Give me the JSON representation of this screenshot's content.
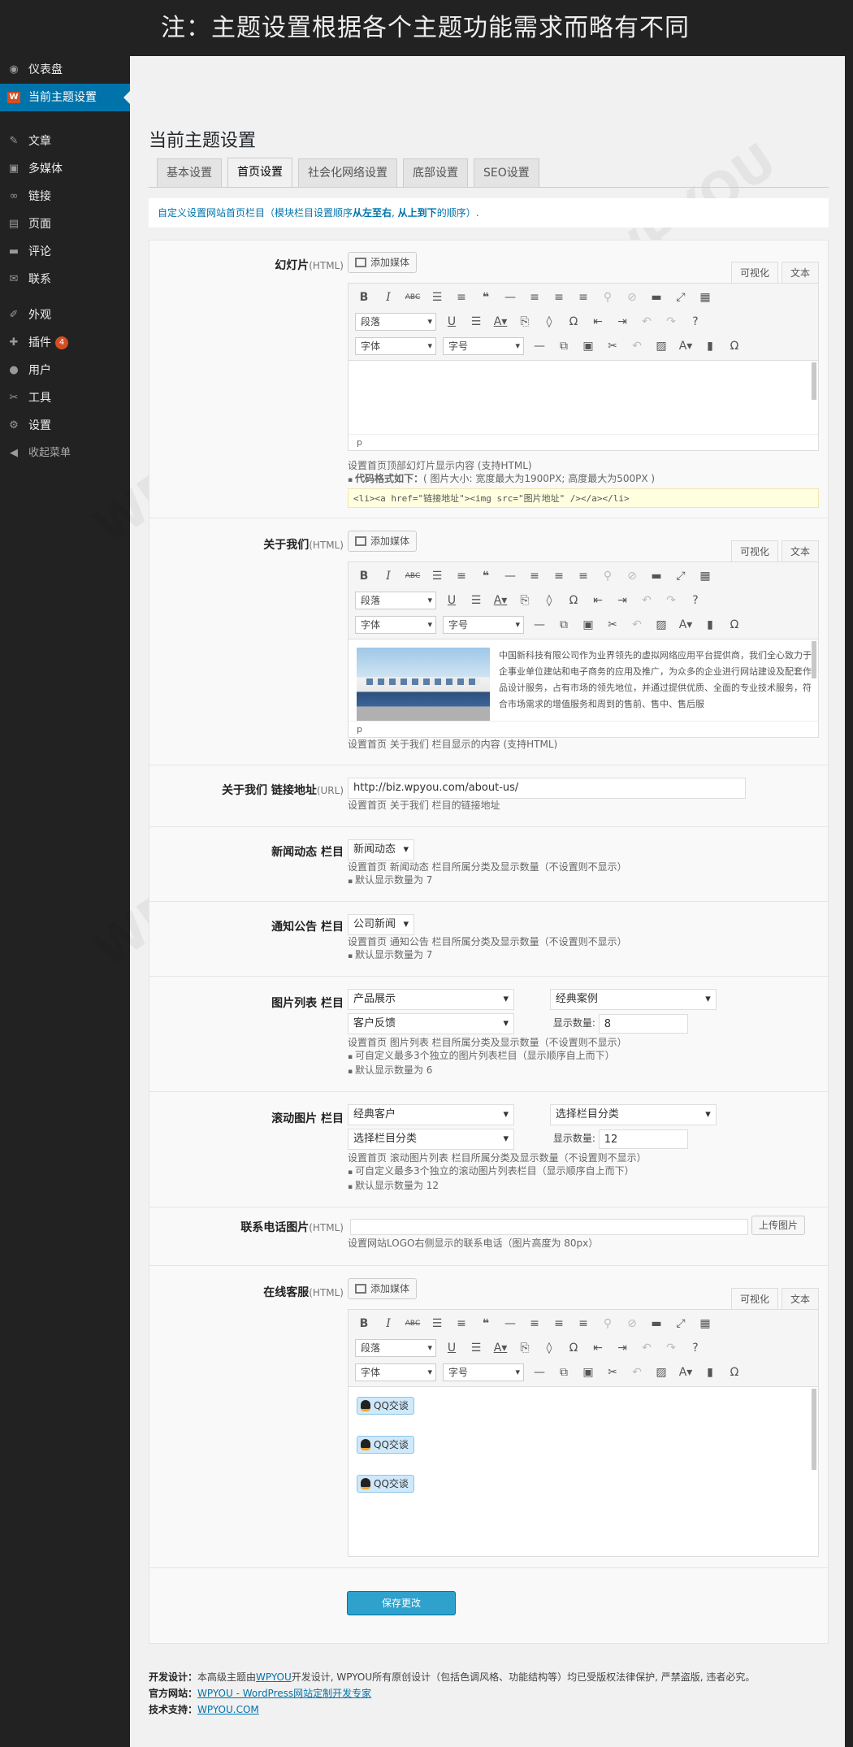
{
  "banner": {
    "text": "注：主题设置根据各个主题功能需求而略有不同"
  },
  "sidebar": {
    "items": [
      {
        "icon": "dashboard-icon",
        "glyph": "◉",
        "label": "仪表盘"
      },
      {
        "icon": "theme-settings-icon",
        "glyph": "W",
        "label": "当前主题设置",
        "active": true
      },
      {
        "icon": "posts-pin-icon",
        "glyph": "✎",
        "label": "文章"
      },
      {
        "icon": "media-icon",
        "glyph": "▣",
        "label": "多媒体"
      },
      {
        "icon": "links-icon",
        "glyph": "∞",
        "label": "链接"
      },
      {
        "icon": "pages-icon",
        "glyph": "▤",
        "label": "页面"
      },
      {
        "icon": "comments-icon",
        "glyph": "▬",
        "label": "评论"
      },
      {
        "icon": "contact-mail-icon",
        "glyph": "✉",
        "label": "联系"
      },
      {
        "icon": "appearance-brush-icon",
        "glyph": "✐",
        "label": "外观"
      },
      {
        "icon": "plugins-icon",
        "glyph": "✚",
        "label": "插件",
        "badge": "4"
      },
      {
        "icon": "users-icon",
        "glyph": "●",
        "label": "用户"
      },
      {
        "icon": "tools-wrench-icon",
        "glyph": "✂",
        "label": "工具"
      },
      {
        "icon": "settings-icon",
        "glyph": "⚙",
        "label": "设置"
      },
      {
        "icon": "collapse-arrow-icon",
        "glyph": "◀",
        "label": "收起菜单"
      }
    ]
  },
  "page": {
    "title": "当前主题设置"
  },
  "tabs": [
    "基本设置",
    "首页设置",
    "社会化网络设置",
    "底部设置",
    "SEO设置"
  ],
  "active_tab": "首页设置",
  "notice": {
    "prefix": "自定义设置网站首页栏目（模块栏目设置顺序",
    "b1": "从左至右",
    "mid": ", ",
    "b2": "从上到下",
    "suffix": "的顺序）."
  },
  "editor_common": {
    "add_media": "添加媒体",
    "visual": "可视化",
    "text": "文本",
    "paragraph": "段落",
    "font": "字体",
    "size": "字号",
    "path": "p"
  },
  "slides": {
    "label": "幻灯片",
    "hint": "(HTML)",
    "desc": "设置首页顶部幻灯片显示内容 (支持HTML)",
    "code_title": "代码格式如下：",
    "code_note": "( 图片大小: 宽度最大为1900PX; 高度最大为500PX )",
    "code": "<li><a href=\"链接地址\"><img src=\"图片地址\" /></a></li>"
  },
  "about": {
    "label": "关于我们",
    "hint": "(HTML)",
    "paragraph": "中国新科技有限公司作为业界领先的虚拟网络应用平台提供商，我们全心致力于企事业单位建站和电子商务的应用及推广，为众多的企业进行网站建设及配套作品设计服务，占有市场的领先地位，并通过提供优质、全面的专业技术服务，符合市场需求的增值服务和周到的售前、售中、售后服",
    "desc": "设置首页 关于我们 栏目显示的内容 (支持HTML)"
  },
  "about_link": {
    "label": "关于我们 链接地址",
    "hint": "(URL)",
    "value": "http://biz.wpyou.com/about-us/",
    "desc": "设置首页 关于我们 栏目的链接地址"
  },
  "news": {
    "label": "新闻动态 栏目",
    "select": "新闻动态",
    "desc": "设置首页 新闻动态 栏目所属分类及显示数量（不设置则不显示）",
    "note": "默认显示数量为 7"
  },
  "notices": {
    "label": "通知公告 栏目",
    "select": "公司新闻",
    "desc": "设置首页 通知公告 栏目所属分类及显示数量（不设置则不显示）",
    "note": "默认显示数量为 7"
  },
  "gallery": {
    "label": "图片列表  栏目",
    "select1": "产品展示",
    "select2": "经典案例",
    "select3": "客户反馈",
    "count_label": "显示数量:",
    "count": "8",
    "desc": "设置首页  图片列表  栏目所属分类及显示数量（不设置则不显示）",
    "note1": "可自定义最多3个独立的图片列表栏目（显示顺序自上而下）",
    "note2": "默认显示数量为  6"
  },
  "scroller": {
    "label": "滚动图片  栏目",
    "select1": "经典客户",
    "select2": "选择栏目分类",
    "select3": "选择栏目分类",
    "count_label": "显示数量:",
    "count": "12",
    "desc": "设置首页  滚动图片列表  栏目所属分类及显示数量（不设置则不显示）",
    "note1": "可自定义最多3个独立的滚动图片列表栏目（显示顺序自上而下）",
    "note2": "默认显示数量为  12"
  },
  "phone_img": {
    "label": "联系电话图片",
    "hint": "(HTML)",
    "upload": "上传图片",
    "desc": "设置网站LOGO右侧显示的联系电话（图片高度为 80px）"
  },
  "service": {
    "label": "在线客服",
    "hint": "(HTML)",
    "qq": [
      "QQ交谈",
      "QQ交谈",
      "QQ交谈"
    ]
  },
  "save": {
    "label": "保存更改"
  },
  "footer": {
    "dev_label": "开发设计：",
    "dev_pre": "本高级主题由",
    "dev_link": "WPYOU",
    "dev_post": "开发设计, WPYOU所有原创设计（包括色调风格、功能结构等）均已受版权法律保护, 严禁盗版, 违者必究。",
    "site_label": "官方网站：",
    "site_link": "WPYOU - WordPress网站定制开发专家",
    "support_label": "技术支持：",
    "support_link": "WPYOU.COM"
  },
  "colors": {
    "accent": "#0073aa",
    "button": "#2ea2cc",
    "sidebar": "#222222",
    "badge": "#d54e21"
  }
}
